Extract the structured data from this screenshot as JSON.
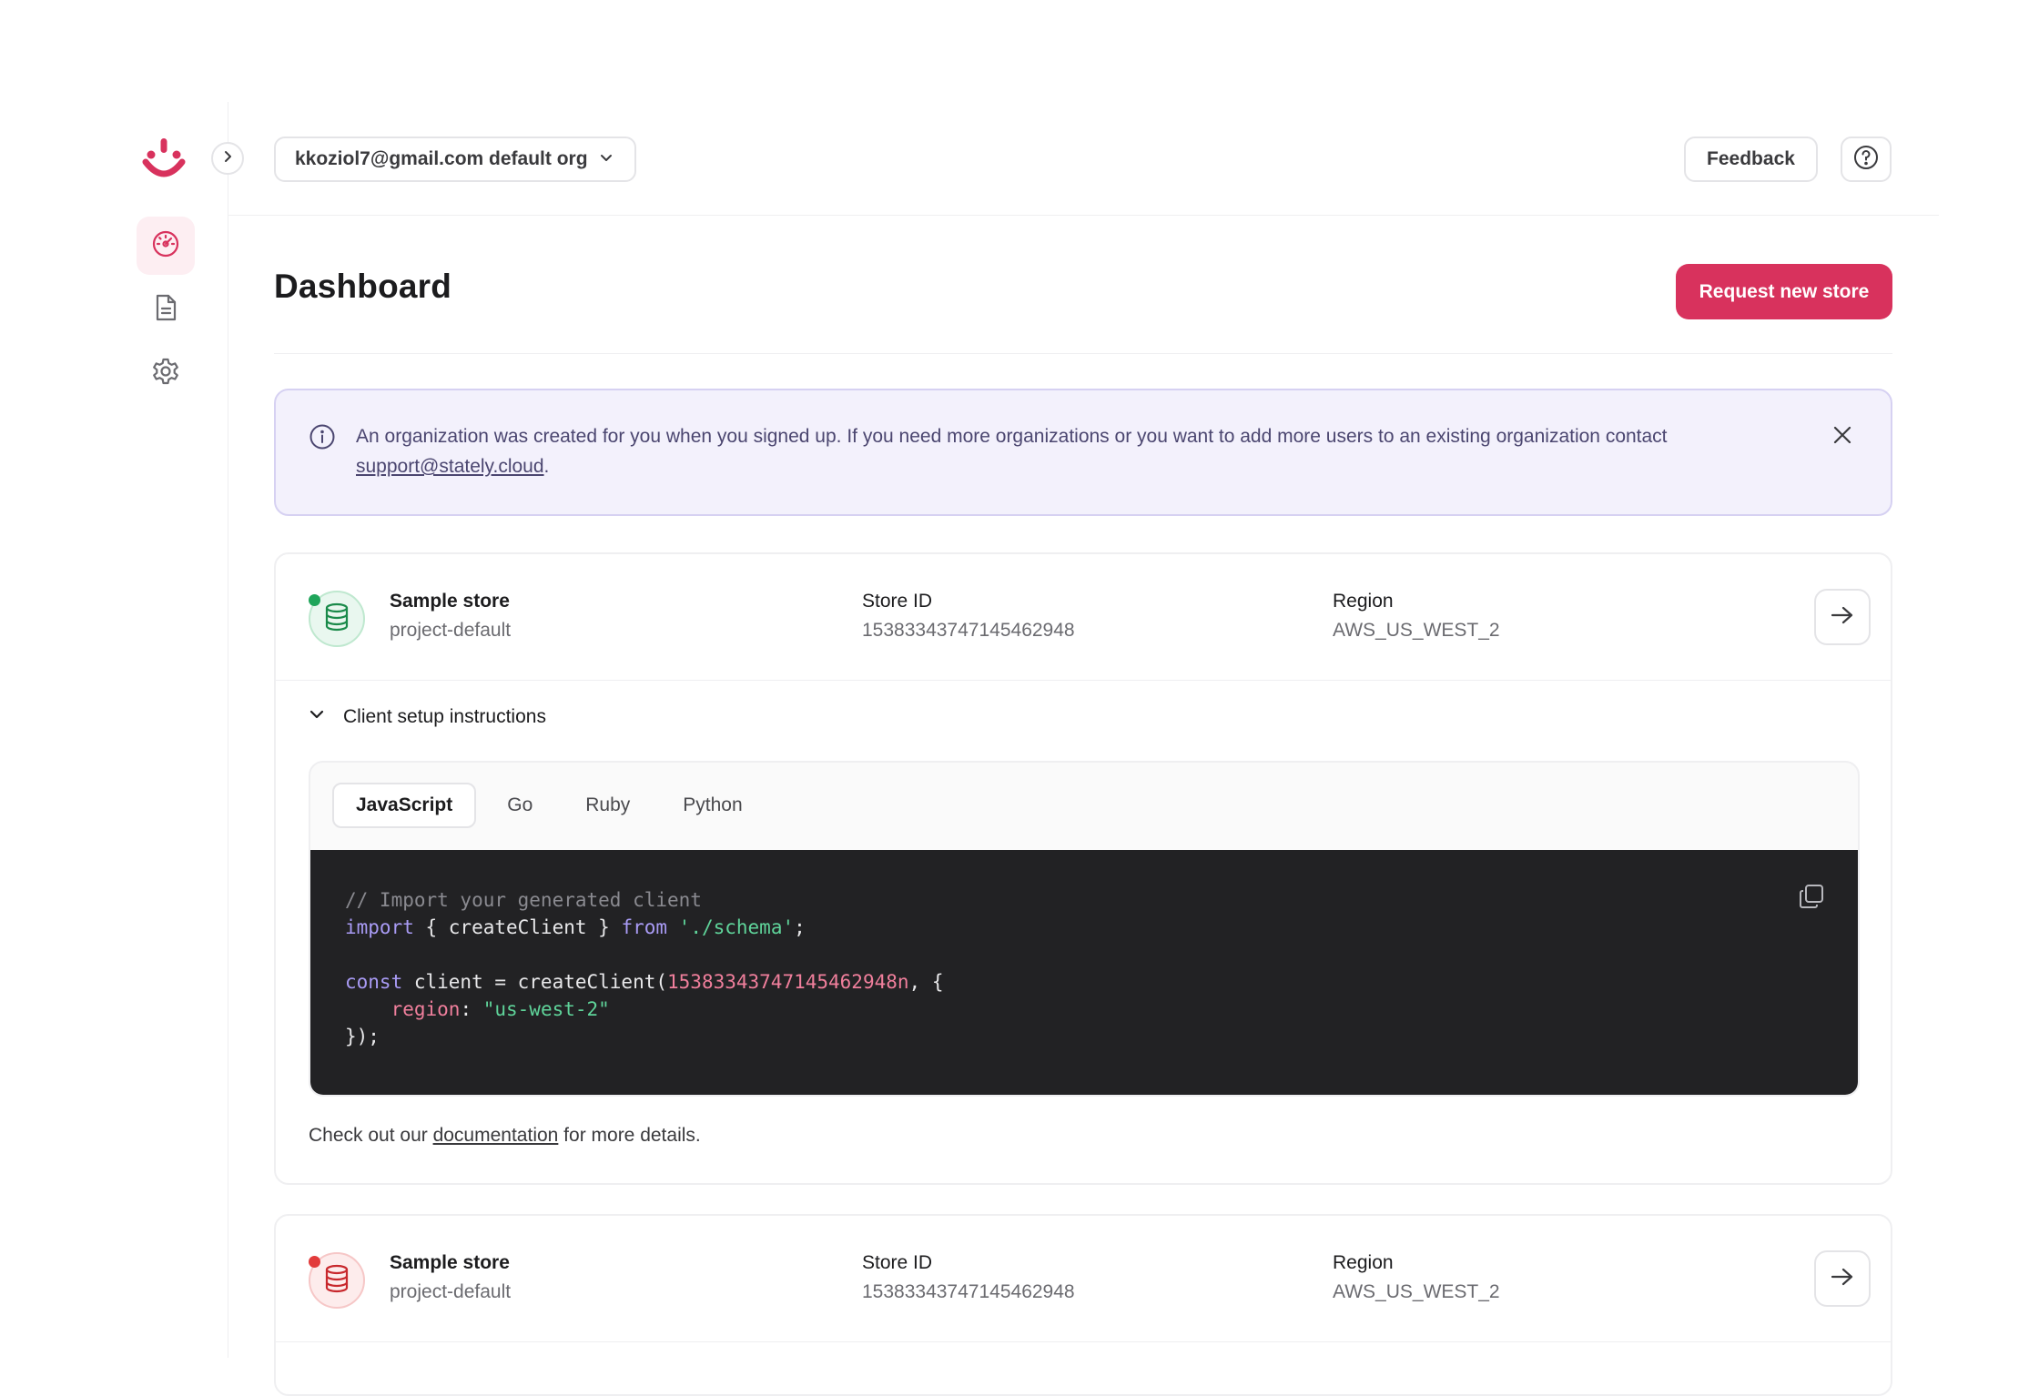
{
  "colors": {
    "brand": "#d8325d",
    "brand_tint": "#fdeef2",
    "info_bg": "#f3f1fc",
    "status_ok": "#1fa55a",
    "status_error": "#e23b3b",
    "code_bg": "#222224"
  },
  "sidebar": {
    "logo": "stately-logo",
    "expand_icon": "chevron-right-icon",
    "items": [
      {
        "icon": "dashboard-gauge-icon",
        "active": true
      },
      {
        "icon": "document-icon",
        "active": false
      },
      {
        "icon": "gear-icon",
        "active": false
      }
    ]
  },
  "topbar": {
    "org_selector": {
      "value": "kkoziol7@gmail.com default org",
      "icon": "chevron-down-icon"
    },
    "feedback_label": "Feedback",
    "help_icon": "question-circle-icon"
  },
  "header": {
    "title": "Dashboard",
    "request_store_label": "Request new store"
  },
  "info_banner": {
    "icon": "info-circle-icon",
    "message": "An organization was created for you when you signed up. If you need more organizations or you want to add more users to an existing organization contact ",
    "link_text": "support@stately.cloud",
    "suffix": ".",
    "close_icon": "close-icon"
  },
  "stores": [
    {
      "name": "Sample store",
      "project": "project-default",
      "status": "ok",
      "store_id_label": "Store ID",
      "store_id": "15383343747145462948",
      "region_label": "Region",
      "region": "AWS_US_WEST_2",
      "setup": {
        "toggle_label": "Client setup instructions",
        "tabs": [
          "JavaScript",
          "Go",
          "Ruby",
          "Python"
        ],
        "active_tab": "JavaScript",
        "code": {
          "comment": "// Import your generated client",
          "import_kw": "import",
          "import_mid": " { createClient } ",
          "from_kw": "from",
          "import_path": "'./schema'",
          "const_kw": "const",
          "const_mid": " client = createClient(",
          "store_literal": "15383343747145462948n",
          "const_end": ", {",
          "region_key": "region",
          "region_value": "\"us-west-2\"",
          "closing": "});"
        },
        "docs_prefix": "Check out our ",
        "docs_link": "documentation",
        "docs_suffix": " for more details."
      }
    },
    {
      "name": "Sample store",
      "project": "project-default",
      "status": "error",
      "store_id_label": "Store ID",
      "store_id": "15383343747145462948",
      "region_label": "Region",
      "region": "AWS_US_WEST_2"
    }
  ]
}
